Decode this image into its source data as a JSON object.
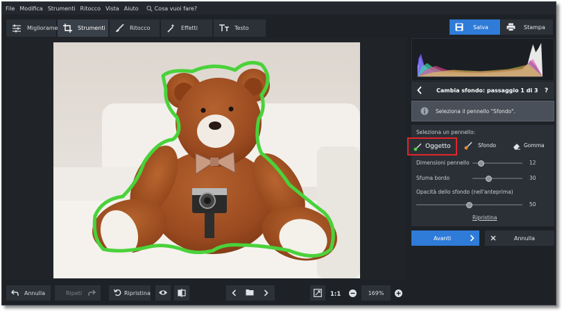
{
  "menu": {
    "items": [
      "File",
      "Modifica",
      "Strumenti",
      "Ritocco",
      "Vista",
      "Aiuto"
    ],
    "search_placeholder": "Cosa vuoi fare?"
  },
  "tabs": [
    {
      "label": "Miglioramento",
      "icon": "sliders-icon"
    },
    {
      "label": "Strumenti",
      "icon": "crop-icon"
    },
    {
      "label": "Ritocco",
      "icon": "brush-icon"
    },
    {
      "label": "Effetti",
      "icon": "magic-wand-icon"
    },
    {
      "label": "Testo",
      "icon": "text-icon"
    }
  ],
  "actions": {
    "save": "Salva",
    "print": "Stampa"
  },
  "panel": {
    "step_title": "Cambia sfondo: passaggio 1 di 3",
    "help": "?",
    "info_text": "Seleziona il pennello \"Sfondo\".",
    "select_brush_label": "Seleziona un pennello:",
    "brushes": {
      "object": "Oggetto",
      "background": "Sfondo",
      "eraser": "Gomma"
    },
    "sliders": {
      "brush_size": {
        "label": "Dimensioni pennello",
        "value": "12",
        "fraction": 0.12
      },
      "feather": {
        "label": "Sfuma bordo",
        "value": "30",
        "fraction": 0.3
      },
      "opacity": {
        "label": "Opacità dello sfondo (nell'anteprima)",
        "value": "50",
        "fraction": 0.5
      }
    },
    "reset_link": "Ripristina",
    "next": "Avanti",
    "cancel": "Annulla"
  },
  "bottom": {
    "undo": "Annulla",
    "redo": "Ripeti",
    "reset": "Ripristina",
    "ratio": "1:1",
    "zoom": "169%"
  },
  "colors": {
    "accent": "#2f7bd8",
    "selection_outline": "#4ad23a",
    "highlight_box": "#e0262a"
  }
}
